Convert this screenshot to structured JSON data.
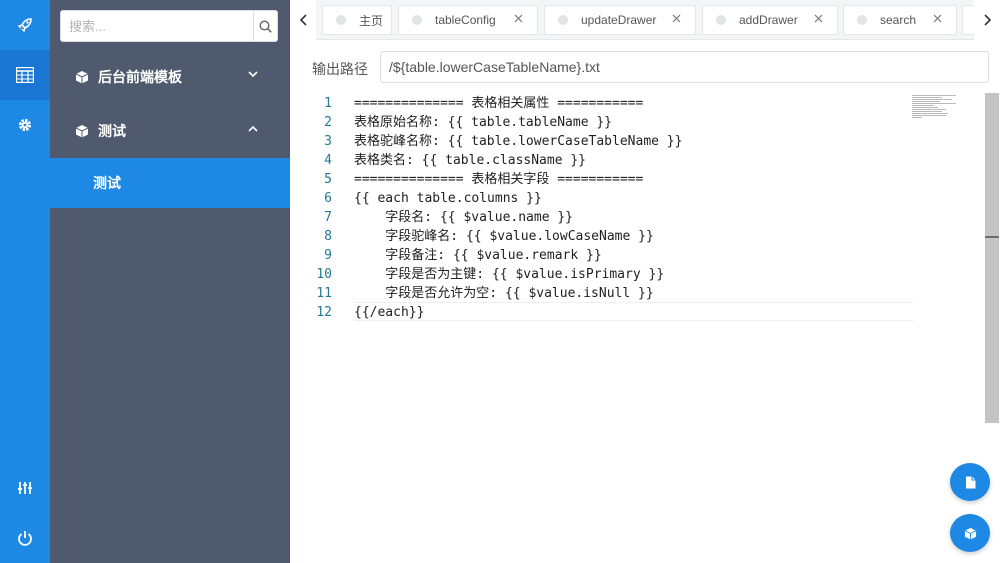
{
  "rail": {
    "items": [
      {
        "icon": "rocket-icon",
        "active": false
      },
      {
        "icon": "grid-icon",
        "active": true
      },
      {
        "icon": "gear-icon",
        "active": false
      },
      {
        "icon": "sliders-icon",
        "active": false
      },
      {
        "icon": "power-icon",
        "active": false
      }
    ]
  },
  "sidebar": {
    "search_placeholder": "搜索...",
    "groups": [
      {
        "label": "后台前端模板",
        "expanded": false,
        "icon": "cube-icon"
      },
      {
        "label": "测试",
        "expanded": true,
        "icon": "cube-icon"
      }
    ],
    "active_item": "测试"
  },
  "tabs": [
    {
      "label": "主页",
      "closable": false
    },
    {
      "label": "tableConfig",
      "closable": true
    },
    {
      "label": "updateDrawer",
      "closable": true
    },
    {
      "label": "addDrawer",
      "closable": true
    },
    {
      "label": "search",
      "closable": true
    }
  ],
  "output": {
    "label": "输出路径",
    "value": "/${table.lowerCaseTableName}.txt"
  },
  "editor": {
    "line_numbers": [
      "1",
      "2",
      "3",
      "4",
      "5",
      "6",
      "7",
      "8",
      "9",
      "10",
      "11",
      "12"
    ],
    "lines": [
      "============== 表格相关属性 ===========",
      "表格原始名称: {{ table.tableName }}",
      "表格驼峰名称: {{ table.lowerCaseTableName }}",
      "表格类名: {{ table.className }}",
      "============== 表格相关字段 ===========",
      "{{ each table.columns }}",
      "    字段名: {{ $value.name }}",
      "    字段驼峰名: {{ $value.lowCaseName }}",
      "    字段备注: {{ $value.remark }}",
      "    字段是否为主键: {{ $value.isPrimary }}",
      "    字段是否允许为空: {{ $value.isNull }}",
      "{{/each}}"
    ]
  },
  "fabs": [
    {
      "icon": "file-icon"
    },
    {
      "icon": "cube-icon"
    }
  ],
  "colors": {
    "accent": "#1e88e5",
    "sidebar_bg": "#4f5a6e",
    "line_number": "#237893"
  }
}
